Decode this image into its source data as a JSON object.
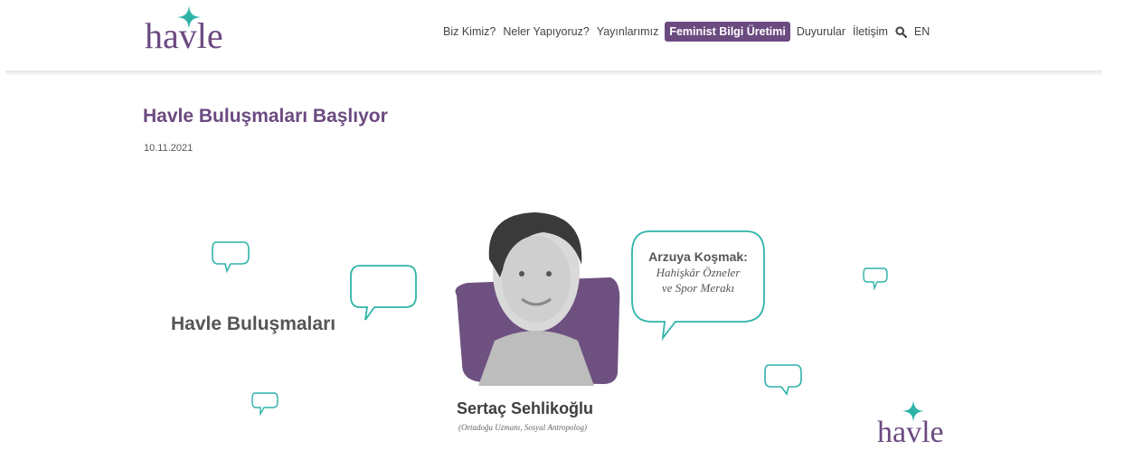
{
  "header": {
    "logo_text": "havle",
    "nav": [
      {
        "label": "Biz Kimiz?"
      },
      {
        "label": "Neler Yapıyoruz?"
      },
      {
        "label": "Yayınlarımız"
      },
      {
        "label": "Feminist Bilgi Üretimi",
        "active": true
      },
      {
        "label": "Duyurular"
      },
      {
        "label": "İletişim"
      }
    ],
    "search_icon": "search-icon",
    "language": "EN"
  },
  "article": {
    "title": "Havle Buluşmaları Başlıyor",
    "date": "10.11.2021"
  },
  "banner": {
    "event_title": "Havle Buluşmaları",
    "talk_title": "Arzuya Koşmak:",
    "talk_subtitle_1": "Hahişkâr Özneler",
    "talk_subtitle_2": "ve Spor Merakı",
    "speaker_name": "Sertaç Sehlikoğlu",
    "speaker_role": "(Ortadoğu Uzmanı, Sosyal Antropolog)",
    "logo_text": "havle"
  },
  "colors": {
    "brand_purple": "#6b4a80",
    "accent_teal": "#2fb3a8",
    "photo_bg": "#6e5180"
  }
}
